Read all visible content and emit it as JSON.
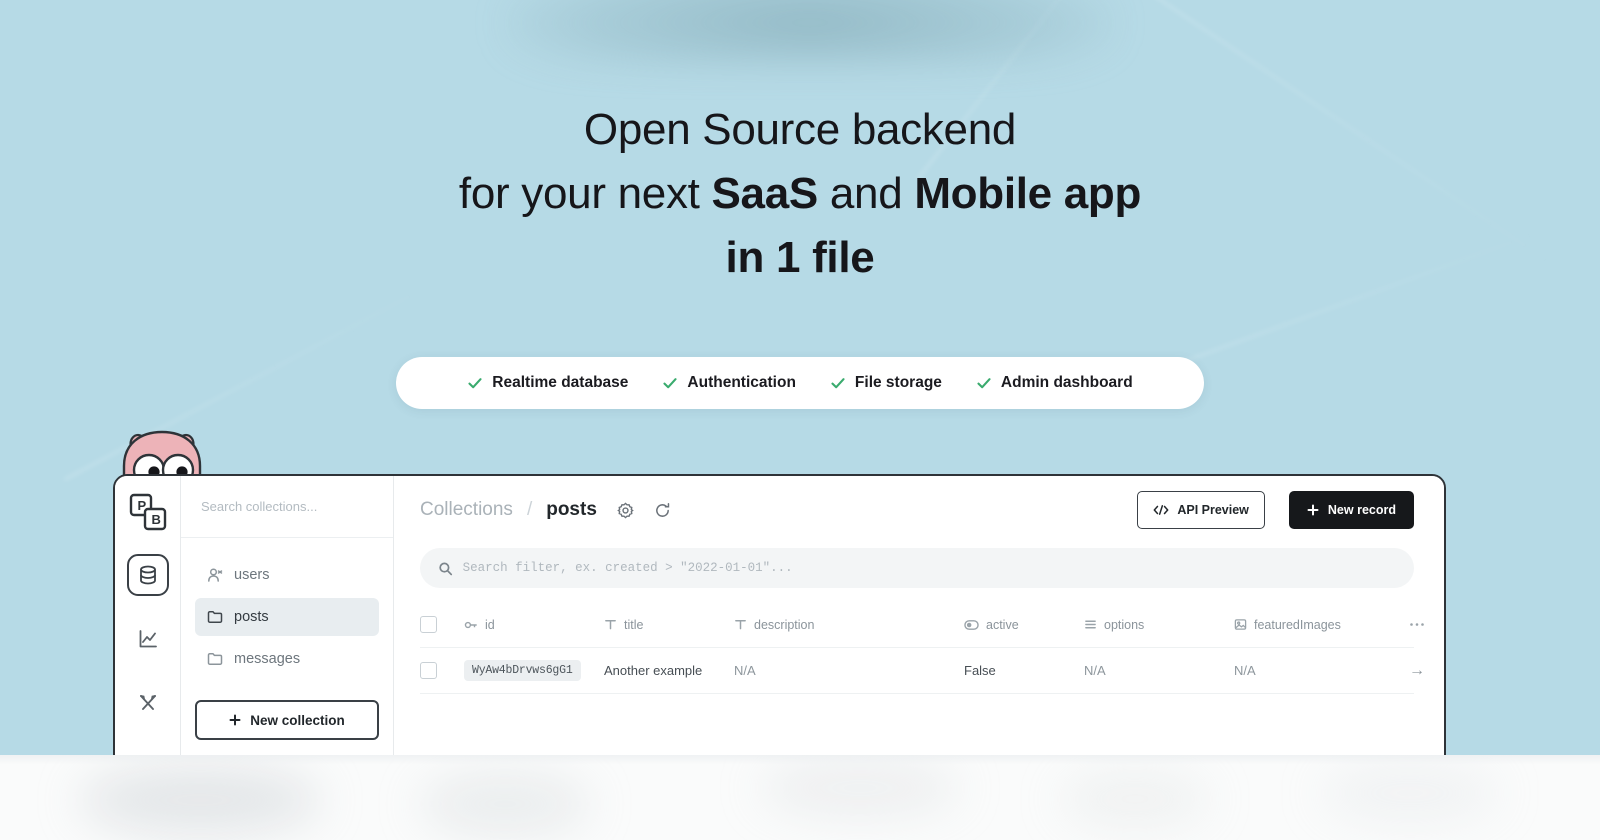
{
  "theme": {
    "background": "#b6dae6",
    "accent_dark": "#16181b",
    "check_green": "#3aab6e",
    "orange": "#f58220"
  },
  "hero": {
    "line1": "Open Source backend",
    "line2_prefix": "for your next ",
    "line2_bold1": "SaaS",
    "line2_middle": " and ",
    "line2_bold2": "Mobile app",
    "line3": "in 1 file"
  },
  "features": [
    {
      "label": "Realtime database",
      "icon": "check-icon"
    },
    {
      "label": "Authentication",
      "icon": "check-icon"
    },
    {
      "label": "File storage",
      "icon": "check-icon"
    },
    {
      "label": "Admin dashboard",
      "icon": "check-icon"
    }
  ],
  "app": {
    "rail": {
      "logo": "pocketbase-logo",
      "items": [
        {
          "name": "collections",
          "icon": "database-icon",
          "active": true
        },
        {
          "name": "logs",
          "icon": "chart-icon",
          "active": false
        },
        {
          "name": "settings",
          "icon": "tools-icon",
          "active": false
        }
      ]
    },
    "sidebar": {
      "search_placeholder": "Search collections...",
      "search_value": "",
      "collections": [
        {
          "label": "users",
          "icon": "users-icon",
          "selected": false
        },
        {
          "label": "posts",
          "icon": "folder-icon",
          "selected": true
        },
        {
          "label": "messages",
          "icon": "folder-icon",
          "selected": false
        }
      ],
      "new_collection_label": "New collection"
    },
    "topbar": {
      "breadcrumb_root": "Collections",
      "breadcrumb_sep": "/",
      "breadcrumb_current": "posts",
      "gear_icon": "gear-icon",
      "refresh_icon": "refresh-icon",
      "api_preview_label": "API Preview",
      "new_record_label": "New record"
    },
    "filter": {
      "placeholder": "Search filter, ex. created > \"2022-01-01\"...",
      "value": "",
      "icon": "search-icon"
    },
    "table": {
      "columns": [
        {
          "label": "id",
          "icon": "key-icon"
        },
        {
          "label": "title",
          "icon": "text-icon"
        },
        {
          "label": "description",
          "icon": "text-icon"
        },
        {
          "label": "active",
          "icon": "toggle-icon"
        },
        {
          "label": "options",
          "icon": "list-icon"
        },
        {
          "label": "featuredImages",
          "icon": "image-icon"
        }
      ],
      "more_icon": "ellipsis-icon",
      "rows": [
        {
          "id": "WyAw4bDrvws6gG1",
          "title": "Another example",
          "description": "N/A",
          "active": "False",
          "options": "N/A",
          "featuredImages": "N/A",
          "open_icon": "arrow-right-icon"
        }
      ]
    }
  }
}
